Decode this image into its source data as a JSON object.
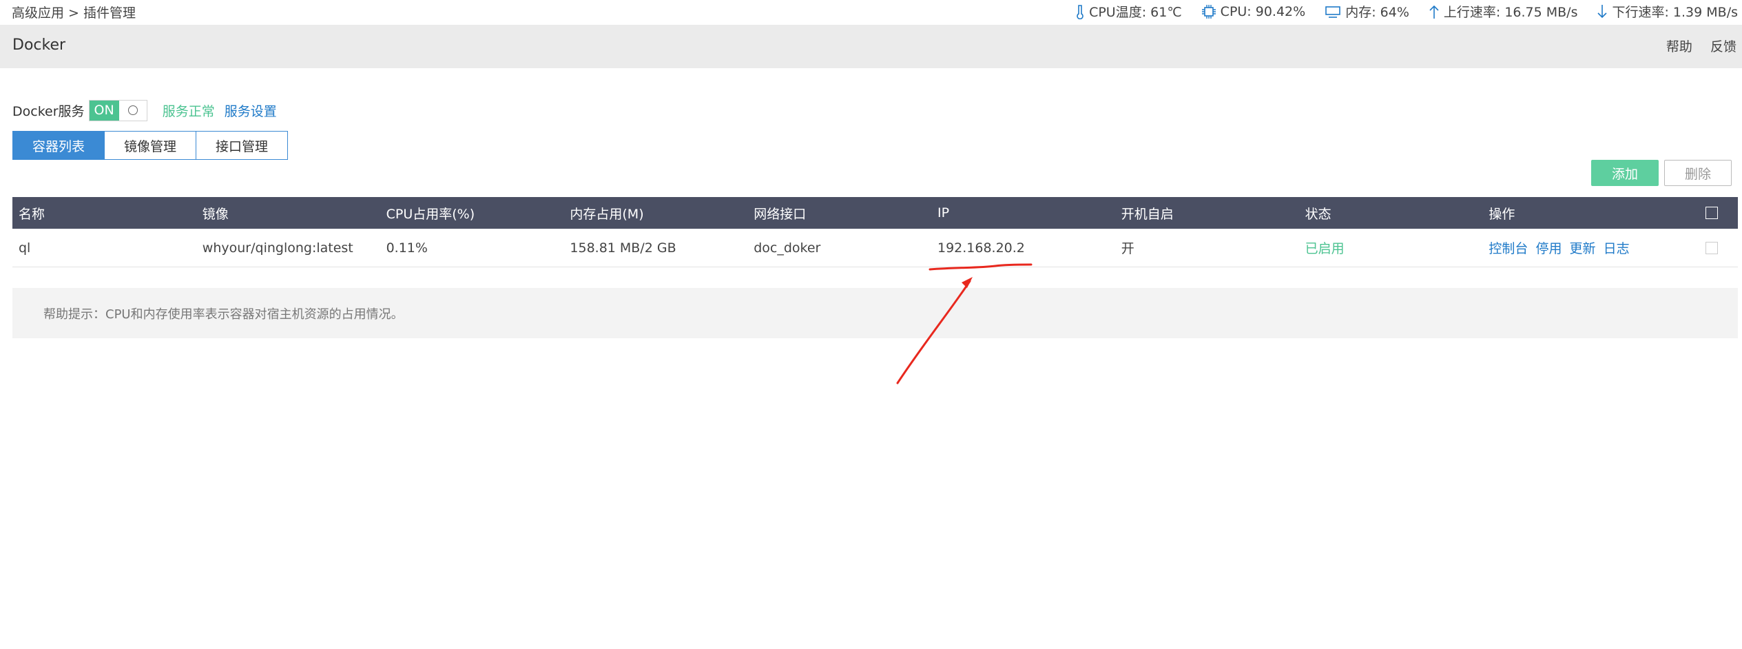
{
  "breadcrumb": "高级应用 > 插件管理",
  "status": {
    "cpu_temp": "CPU温度: 61℃",
    "cpu_usage": "CPU: 90.42%",
    "memory": "内存: 64%",
    "upload": "上行速率: 16.75 MB/s",
    "download": "下行速率: 1.39 MB/s"
  },
  "header": {
    "title": "Docker",
    "help": "帮助",
    "feedback": "反馈"
  },
  "service": {
    "label": "Docker服务",
    "toggle_on": "ON",
    "status": "服务正常",
    "settings_link": "服务设置"
  },
  "tabs": [
    {
      "label": "容器列表",
      "active": true
    },
    {
      "label": "镜像管理",
      "active": false
    },
    {
      "label": "接口管理",
      "active": false
    }
  ],
  "actions": {
    "add": "添加",
    "delete": "删除"
  },
  "table": {
    "headers": [
      "名称",
      "镜像",
      "CPU占用率(%)",
      "内存占用(M)",
      "网络接口",
      "IP",
      "开机自启",
      "状态",
      "操作"
    ],
    "rows": [
      {
        "name": "ql",
        "image": "whyour/qinglong:latest",
        "cpu": "0.11%",
        "memory": "158.81 MB/2 GB",
        "network": "doc_doker",
        "ip": "192.168.20.2",
        "autostart": "开",
        "state": "已启用",
        "ops": [
          "控制台",
          "停用",
          "更新",
          "日志"
        ]
      }
    ]
  },
  "help_tip": "帮助提示：CPU和内存使用率表示容器对宿主机资源的占用情况。",
  "colors": {
    "accent_blue": "#3b8ad4",
    "success_green": "#4cc391",
    "table_header": "#4a4f63",
    "annotation_red": "#e8281e"
  }
}
